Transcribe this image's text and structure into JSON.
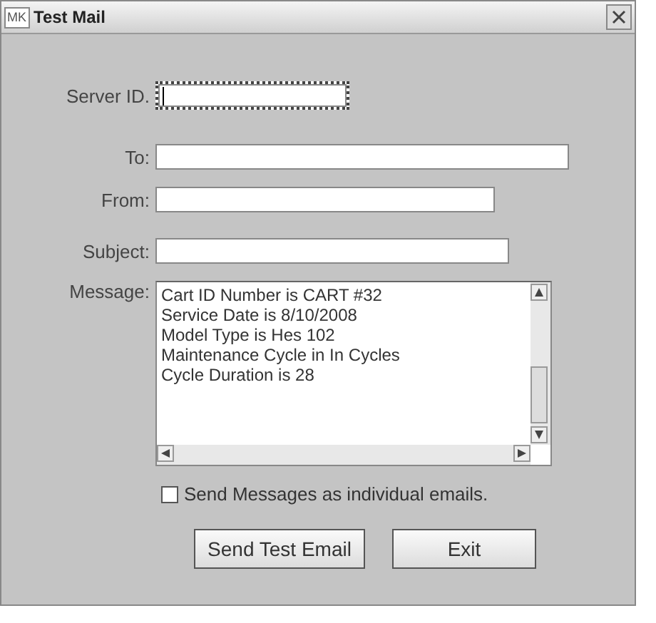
{
  "window": {
    "title": "Test Mail",
    "icon_text": "MK"
  },
  "fields": [
    {
      "label": "Server ID.",
      "focused": true
    },
    {
      "label": "To:",
      "focused": false
    },
    {
      "label": "From:",
      "focused": false
    },
    {
      "label": "Subject:",
      "focused": false
    }
  ],
  "message": {
    "label": "Message:",
    "lines": [
      "Cart ID Number is CART #32",
      "Service Date is 8/10/2008",
      "Model Type is Hes 102",
      "Maintenance Cycle in In Cycles",
      "Cycle Duration is 28"
    ]
  },
  "individual_emails": {
    "label": "Send Messages as individual emails.",
    "checked": false
  },
  "buttons": [
    {
      "label": "Send Test Email"
    },
    {
      "label": "Exit"
    }
  ]
}
